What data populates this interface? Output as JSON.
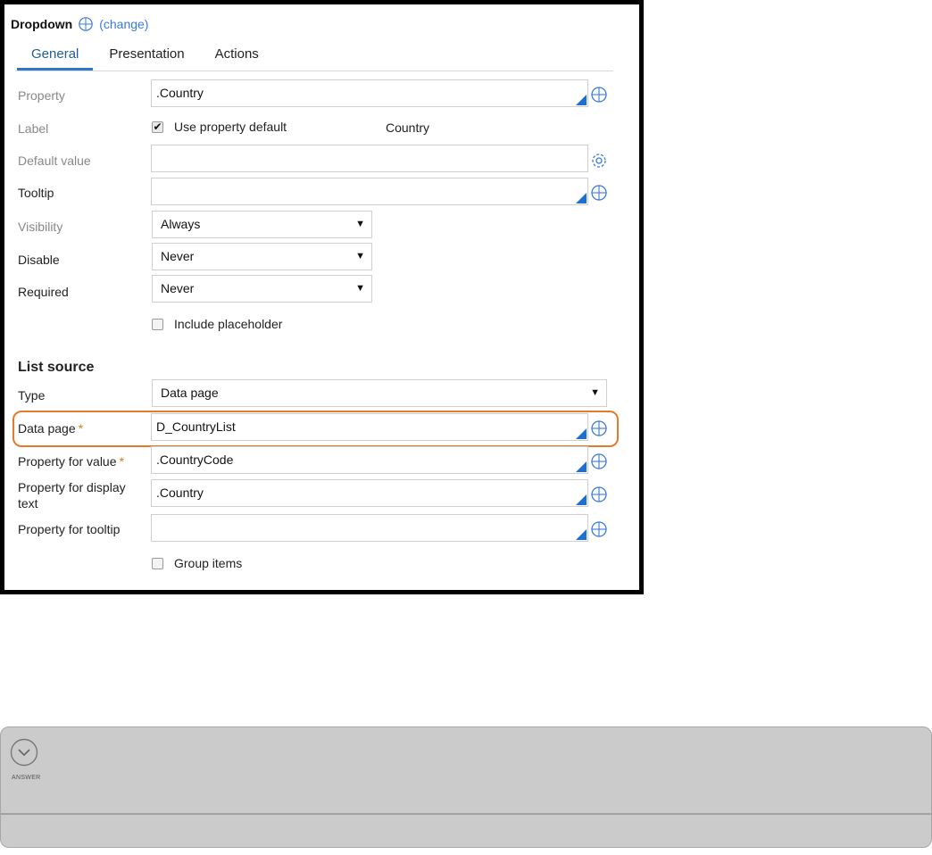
{
  "header": {
    "title": "Dropdown",
    "change_link": "(change)"
  },
  "tabs": [
    {
      "label": "General",
      "active": true
    },
    {
      "label": "Presentation",
      "active": false
    },
    {
      "label": "Actions",
      "active": false
    }
  ],
  "fields": {
    "property": {
      "label": "Property",
      "value": ".Country"
    },
    "label": {
      "label": "Label",
      "checkbox_label": "Use property default",
      "checked": true,
      "value": "Country"
    },
    "default_value": {
      "label": "Default value",
      "value": ""
    },
    "tooltip": {
      "label": "Tooltip",
      "value": ""
    },
    "visibility": {
      "label": "Visibility",
      "value": "Always"
    },
    "disable": {
      "label": "Disable",
      "value": "Never"
    },
    "required": {
      "label": "Required",
      "value": "Never"
    },
    "include_placeholder": {
      "label": "Include placeholder",
      "checked": false
    }
  },
  "list_source": {
    "heading": "List source",
    "type": {
      "label": "Type",
      "value": "Data page"
    },
    "data_page": {
      "label": "Data page",
      "required_mark": "*",
      "value": "D_CountryList"
    },
    "property_for_value": {
      "label": "Property for value",
      "required_mark": "*",
      "value": ".CountryCode"
    },
    "property_for_display_text": {
      "label_line1": "Property for display",
      "label_line2": "text",
      "value": ".Country"
    },
    "property_for_tooltip": {
      "label": "Property for tooltip",
      "value": ""
    },
    "group_items": {
      "label": "Group items",
      "checked": false
    }
  },
  "answer": {
    "label": "ANSWER"
  },
  "colors": {
    "accent": "#2e79c4",
    "highlight": "#e57a2a",
    "corner": "#1f6fd0",
    "required": "#e07a1a"
  }
}
